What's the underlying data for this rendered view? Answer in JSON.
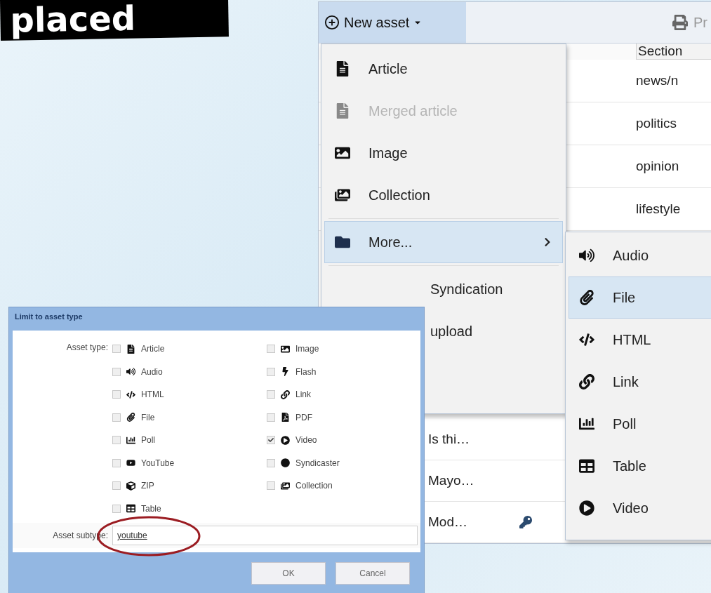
{
  "banner": {
    "title": "placed"
  },
  "app": {
    "toolbar": {
      "new_asset": "New asset",
      "print": "Pr"
    },
    "table": {
      "header": "Section",
      "top_rows": [
        {
          "section": "news/n"
        },
        {
          "section": "politics"
        },
        {
          "section": "opinion"
        },
        {
          "section": "lifestyle"
        }
      ],
      "bottom_rows": [
        {
          "title": "Is thi…",
          "locked": false
        },
        {
          "title": "Mayo…",
          "locked": false
        },
        {
          "title": "Mod…",
          "locked": true
        }
      ]
    }
  },
  "menu": {
    "items": [
      {
        "label": "Article",
        "disabled": false,
        "selected": false,
        "submenu": false
      },
      {
        "label": "Merged article",
        "disabled": true,
        "selected": false,
        "submenu": false
      },
      {
        "label": "Image",
        "disabled": false,
        "selected": false,
        "submenu": false
      },
      {
        "label": "Collection",
        "disabled": false,
        "selected": false,
        "submenu": false
      },
      {
        "label": "More...",
        "disabled": false,
        "selected": true,
        "submenu": true
      }
    ],
    "items_below": [
      "Syndication",
      "upload"
    ]
  },
  "submenu": {
    "items": [
      {
        "label": "Audio",
        "selected": false
      },
      {
        "label": "File",
        "selected": true
      },
      {
        "label": "HTML",
        "selected": false
      },
      {
        "label": "Link",
        "selected": false
      },
      {
        "label": "Poll",
        "selected": false
      },
      {
        "label": "Table",
        "selected": false
      },
      {
        "label": "Video",
        "selected": false
      }
    ]
  },
  "dialog": {
    "title": "Limit to asset type",
    "asset_type_label": "Asset type:",
    "columns": [
      [
        {
          "label": "Article",
          "checked": false
        },
        {
          "label": "Audio",
          "checked": false
        },
        {
          "label": "HTML",
          "checked": false
        },
        {
          "label": "File",
          "checked": false
        },
        {
          "label": "Poll",
          "checked": false
        },
        {
          "label": "YouTube",
          "checked": false
        },
        {
          "label": "ZIP",
          "checked": false
        },
        {
          "label": "Table",
          "checked": false
        }
      ],
      [
        {
          "label": "Image",
          "checked": false
        },
        {
          "label": "Flash",
          "checked": false
        },
        {
          "label": "Link",
          "checked": false
        },
        {
          "label": "PDF",
          "checked": false
        },
        {
          "label": "Video",
          "checked": true
        },
        {
          "label": "Syndicaster",
          "checked": false
        },
        {
          "label": "Collection",
          "checked": false
        }
      ]
    ],
    "subtype_label": "Asset subtype:",
    "subtype_value": "youtube",
    "buttons": [
      "OK",
      "Cancel"
    ]
  }
}
